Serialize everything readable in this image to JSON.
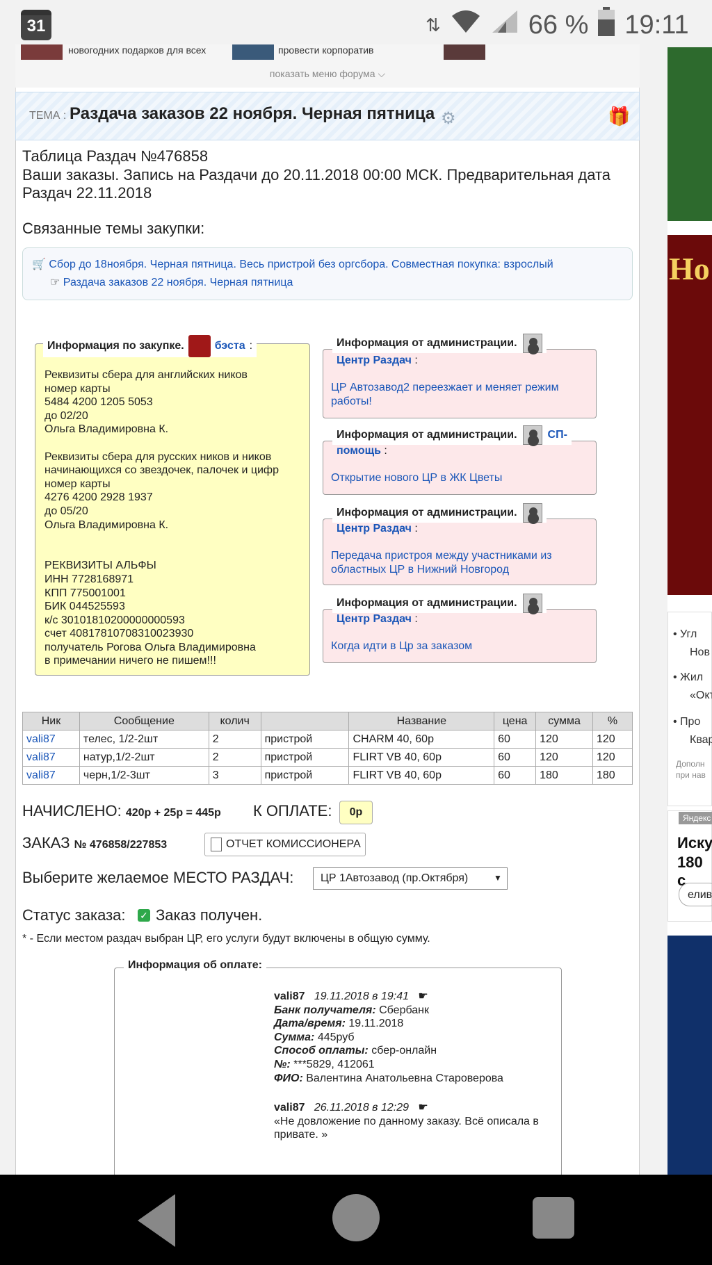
{
  "status_bar": {
    "calendar_day": "31",
    "battery": "66 %",
    "time": "19:11"
  },
  "forum_strip": {
    "item1": "новогодних подарков для всех",
    "item2": "провести корпоратив",
    "menu_toggle": "показать меню форума"
  },
  "topic": {
    "prefix": "ТЕМА :",
    "title": "Раздача заказов 22 ноября. Черная пятница"
  },
  "table_info": {
    "title": "Таблица Раздач №476858",
    "subtitle": "Ваши заказы. Запись на Раздачи до 20.11.2018 00:00 МСК. Предварительная дата Раздач 22.11.2018",
    "related_heading": "Связанные темы закупки:",
    "related_1": "Сбор до 18ноября. Черная пятница. Весь пристрой без оргсбора. Совместная покупка: взрослый",
    "related_2": "Раздача заказов 22 ноября. Черная пятница"
  },
  "purchase_info": {
    "legend": "Информация по закупке.",
    "author": "бэста",
    "text": "Реквизиты сбера для английских ников\nномер карты\n5484 4200 1205 5053\nдо 02/20\nОльга Владимировна К.\n\nРеквизиты сбера для русских ников и ников начинающихся со звездочек, палочек и цифр\nномер карты\n4276 4200 2928 1937\nдо 05/20\nОльга Владимировна К.\n\n\nРЕКВИЗИТЫ АЛЬФЫ\nИНН 7728168971\nКПП 775001001\nБИК 044525593\nк/с 30101810200000000593\nсчет 40817810708310023930\nполучатель Рогова Ольга Владимировна\nв примечании ничего не пишем!!!"
  },
  "admin_notices": [
    {
      "legend": "Информация от администрации.",
      "sender": "Центр Раздач",
      "body": "ЦР Автозавод2 переезжает и меняет режим работы!"
    },
    {
      "legend": "Информация от администрации.",
      "sender": "СП-помощь",
      "body": "Открытие нового ЦР в ЖК Цветы"
    },
    {
      "legend": "Информация от администрации.",
      "sender": "Центр Раздач",
      "body": "Передача пристроя между участниками из областных ЦР в Нижний Новгород"
    },
    {
      "legend": "Информация от администрации.",
      "sender": "Центр Раздач",
      "body": "Когда идти в Цр за заказом"
    }
  ],
  "orders": {
    "headers": [
      "Ник",
      "Сообщение",
      "колич",
      "",
      "Название",
      "цена",
      "сумма",
      "%"
    ],
    "rows": [
      [
        "vali87",
        "телес, 1/2-2шт",
        "2",
        "пристрой",
        "CHARM 40, 60р",
        "60",
        "120",
        "120"
      ],
      [
        "vali87",
        "натур,1/2-2шт",
        "2",
        "пристрой",
        "FLIRT VB 40, 60р",
        "60",
        "120",
        "120"
      ],
      [
        "vali87",
        "черн,1/2-3шт",
        "3",
        "пристрой",
        "FLIRT VB 40, 60р",
        "60",
        "180",
        "180"
      ]
    ]
  },
  "summary": {
    "accrued_label": "НАЧИСЛЕНО:",
    "accrued_value": "420р + 25р = 445р",
    "to_pay_label": "К ОПЛАТЕ:",
    "to_pay_value": "0р",
    "order_label": "ЗАКАЗ",
    "order_number": "№ 476858/227853",
    "report_button": "ОТЧЕТ КОМИССИОНЕРА",
    "place_label": "Выберите желаемое МЕСТО РАЗДАЧ:",
    "place_selected": "ЦР 1Автозавод (пр.Октября)",
    "status_label": "Статус заказа:",
    "status_value": "Заказ получен.",
    "footnote": "* - Если местом раздач выбран ЦР, его услуги будут включены в общую сумму."
  },
  "payment_info": {
    "legend": "Информация об оплате:",
    "entry1": {
      "user": "vali87",
      "date": "19.11.2018 в 19:41",
      "bank_label": "Банк получателя:",
      "bank": "Сбербанк",
      "datetime_label": "Дата/время:",
      "datetime": "19.11.2018",
      "sum_label": "Сумма:",
      "sum": "445руб",
      "method_label": "Способ оплаты:",
      "method": "сбер-онлайн",
      "num_label": "№:",
      "num": "***5829, 412061",
      "fio_label": "ФИО:",
      "fio": "Валентина Анатольевна Староверова"
    },
    "entry2": {
      "user": "vali87",
      "date": "26.11.2018 в 12:29",
      "text": "«Не довложение по данному заказу. Всё описала в привате. »"
    }
  },
  "sidebar": {
    "ad_text": "Но",
    "news1": "Угл",
    "news1b": "Нов",
    "news2": "Жил",
    "news2b": "«Окт",
    "news3": "Про",
    "news3b": "Квар",
    "small1": "Дополн",
    "small2": "при нав",
    "yandex": "Яндекс",
    "ad2a": "Иску",
    "ad2b": "180 с",
    "ad2c": "елив"
  }
}
